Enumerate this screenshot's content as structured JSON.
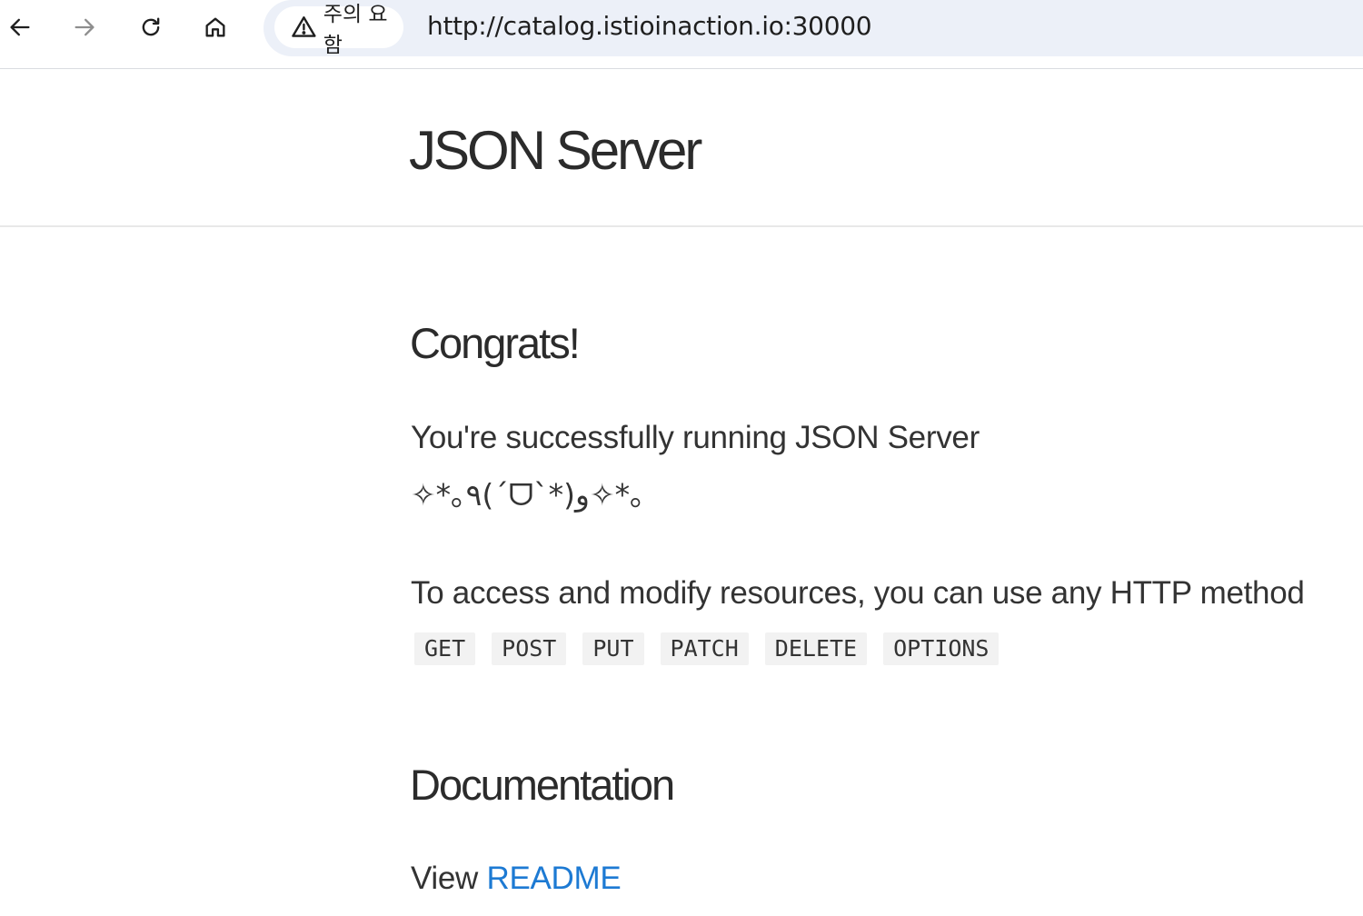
{
  "browser": {
    "security_label": "주의 요함",
    "url": "http://catalog.istioinaction.io:30000"
  },
  "page": {
    "title": "JSON Server",
    "congrats_heading": "Congrats!",
    "running_text": "You're successfully running JSON Server",
    "kaomoji": "✧*｡٩(ˊᗜˋ*)و✧*｡",
    "access_text": "To access and modify resources, you can use any HTTP method",
    "methods": [
      "GET",
      "POST",
      "PUT",
      "PATCH",
      "DELETE",
      "OPTIONS"
    ],
    "docs_heading": "Documentation",
    "view_prefix": "View",
    "readme_link": "README"
  },
  "colors": {
    "link": "#1d7ad3",
    "omnibox_bg": "#ecf0f8",
    "code_bg": "#f2f2f2"
  }
}
